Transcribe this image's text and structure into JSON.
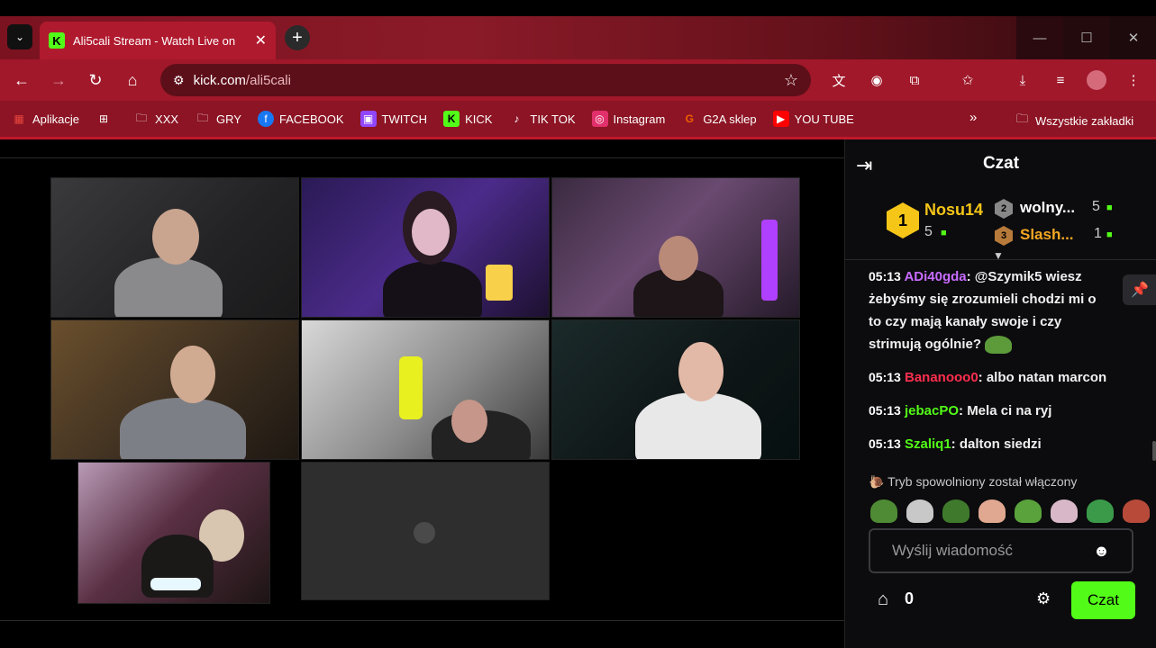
{
  "browser": {
    "tab": {
      "title": "Ali5cali Stream - Watch Live on",
      "favicon_letter": "K"
    },
    "url_host": "kick.com",
    "url_path": "/ali5cali",
    "bookmarks": [
      {
        "label": "Aplikacje",
        "icon": "apps-grid-icon",
        "color": "#e9473e"
      },
      {
        "label": "",
        "icon": "tiles-icon",
        "color": "#ffffff"
      },
      {
        "label": "XXX",
        "icon": "folder-icon",
        "color": "#ffffff"
      },
      {
        "label": "GRY",
        "icon": "folder-icon",
        "color": "#ffffff"
      },
      {
        "label": "FACEBOOK",
        "icon": "facebook-icon",
        "color": "#1877f2"
      },
      {
        "label": "TWITCH",
        "icon": "twitch-icon",
        "color": "#9146ff"
      },
      {
        "label": "KICK",
        "icon": "kick-icon",
        "color": "#53fc18"
      },
      {
        "label": "TIK TOK",
        "icon": "tiktok-icon",
        "color": "#000000"
      },
      {
        "label": "Instagram",
        "icon": "instagram-icon",
        "color": "#e1306c"
      },
      {
        "label": "G2A sklep",
        "icon": "g2a-icon",
        "color": "#f05f00"
      },
      {
        "label": "YOU TUBE",
        "icon": "youtube-icon",
        "color": "#ff0000"
      }
    ],
    "bookmarks_more": "»",
    "all_bookmarks": "Wszystkie zakładki"
  },
  "chat": {
    "title": "Czat",
    "leaderboard": {
      "first": {
        "rank": "1",
        "name": "Nosu14",
        "count": "5",
        "color": "#f5c518"
      },
      "second": {
        "rank": "2",
        "name": "wolny...",
        "count": "5",
        "color": "#ffffff"
      },
      "third": {
        "rank": "3",
        "name": "Slash...",
        "count": "1",
        "color": "#f5a623"
      }
    },
    "messages": [
      {
        "time": "05:13",
        "user": "ADi40gda",
        "user_color": "#c86cff",
        "text": "@Szymik5 wiesz żebyśmy się zrozumieli chodzi mi o to czy mają kanały swoje i czy strimują ogólnie?",
        "emote": "pepe-emote"
      },
      {
        "time": "05:13",
        "user": "Bananooo0",
        "user_color": "#ff2e4f",
        "text": "albo natan marcon"
      },
      {
        "time": "05:13",
        "user": "jebacPO",
        "user_color": "#53fc18",
        "text": "Mela ci na ryj"
      },
      {
        "time": "05:13",
        "user": "Szaliq1",
        "user_color": "#53fc18",
        "text": "dalton siedzi"
      }
    ],
    "slow_mode": "Tryb spowolniony został włączony",
    "input_placeholder": "Wyślij wiadomość",
    "points": "0",
    "send_label": "Czat"
  },
  "colors": {
    "kick_green": "#53fc18",
    "browser_red": "#a0182a"
  }
}
